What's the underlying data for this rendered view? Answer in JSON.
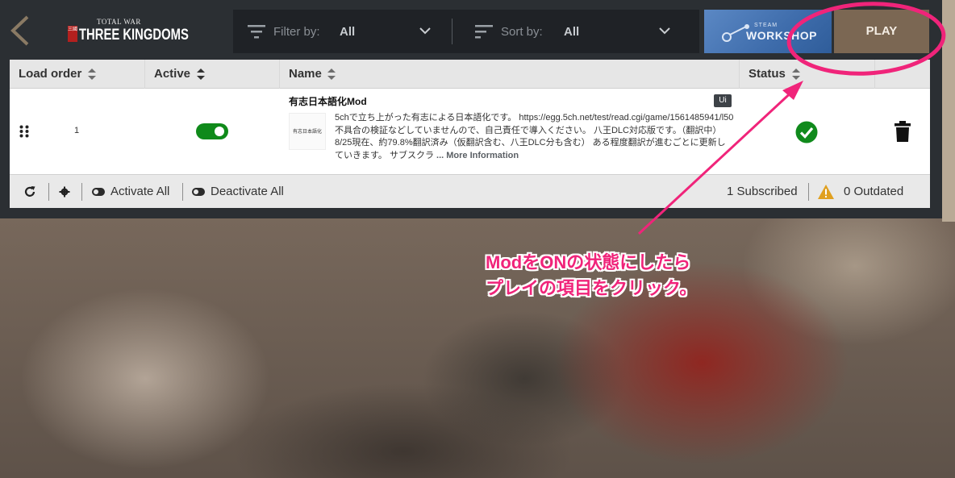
{
  "header": {
    "logo_small": "TOTAL WAR",
    "logo_big": "THREE KINGDOMS",
    "logo_seal": "三國"
  },
  "filter": {
    "label": "Filter by:",
    "value": "All"
  },
  "sort": {
    "label": "Sort by:",
    "value": "All"
  },
  "workshop": {
    "small": "STEAM",
    "big": "WORKSHOP"
  },
  "play_label": "PLAY",
  "table": {
    "columns": [
      "Load order",
      "Active",
      "Name",
      "Status"
    ],
    "rows": [
      {
        "order": "1",
        "active": true,
        "name": "有志日本語化Mod",
        "badge": "Ui",
        "thumb_text": "有志日本語化",
        "description": "5chで立ち上がった有志による日本語化です。 https://egg.5ch.net/test/read.cgi/game/1561485941/l50 不具合の検証などしていませんので、自己責任で導入ください。 八王DLC対応版です。（翻訳中） 8/25現在、約79.8%翻訳済み（仮翻訳含む、八王DLC分も含む） ある程度翻訳が進むごとに更新していきます。 サブスクラ",
        "more": "... More Information",
        "status": "ok"
      }
    ]
  },
  "footer": {
    "activate_all": "Activate All",
    "deactivate_all": "Deactivate All",
    "subscribed": "1 Subscribed",
    "outdated": "0 Outdated"
  },
  "annotation": {
    "line1": "ModをONの状態にしたら",
    "line2": "プレイの項目をクリック。"
  },
  "colors": {
    "accent_green": "#0f8a1a",
    "play_bg": "#7b6753",
    "annotation_pink": "#f0247a"
  }
}
